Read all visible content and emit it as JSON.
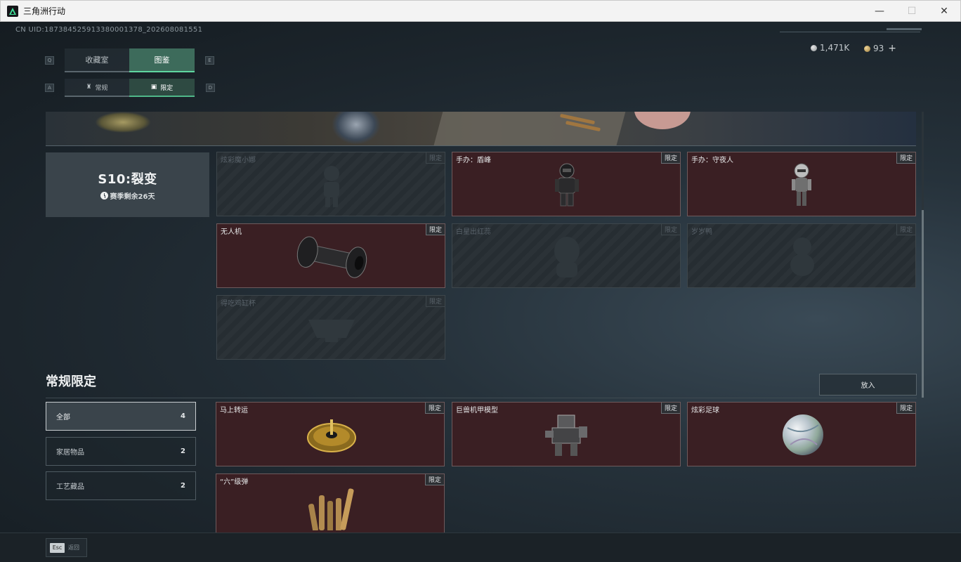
{
  "window": {
    "title": "三角洲行动",
    "minimize": "—",
    "maximize": "☐",
    "close": "✕"
  },
  "header": {
    "uid": "CN UID:18738452591338000137​8_202608081551"
  },
  "currency": {
    "silver": "1,471K",
    "gold": "93",
    "plus": "+"
  },
  "keys": {
    "q": "Q",
    "e": "E",
    "a": "A",
    "d": "D"
  },
  "tabs": {
    "collection_room": "收藏室",
    "catalog": "图鉴"
  },
  "subtabs": {
    "normal": "常规",
    "limited": "限定"
  },
  "season": {
    "name": "S10:裂变",
    "remain": "赛季剩余26天"
  },
  "limited_tag": "限定",
  "season_items": [
    {
      "name": "炫彩魔小娜",
      "owned": false
    },
    {
      "name": "手办：盾峰",
      "owned": true
    },
    {
      "name": "手办：守夜人",
      "owned": true
    },
    {
      "name": "无人机",
      "owned": true
    },
    {
      "name": "白星出红蕊",
      "owned": false
    },
    {
      "name": "岁岁鸭",
      "owned": false
    },
    {
      "name": "得吃鸡缸杯",
      "owned": false
    }
  ],
  "section": {
    "title": "常规限定",
    "put_button": "放入"
  },
  "filters": [
    {
      "label": "全部",
      "count": "4"
    },
    {
      "label": "家居物品",
      "count": "2"
    },
    {
      "label": "工艺藏品",
      "count": "2"
    }
  ],
  "regular_items": [
    {
      "name": "马上转运",
      "owned": true
    },
    {
      "name": "巨兽机甲模型",
      "owned": true
    },
    {
      "name": "炫彩足球",
      "owned": true
    },
    {
      "name": "“六”级弹",
      "owned": true
    }
  ],
  "footer": {
    "esc_key": "Esc",
    "back_label": "返回"
  },
  "colors": {
    "accent": "#5fd6a0",
    "owned_card": "#3a1f23",
    "tag_bg": "#2c2f33"
  }
}
